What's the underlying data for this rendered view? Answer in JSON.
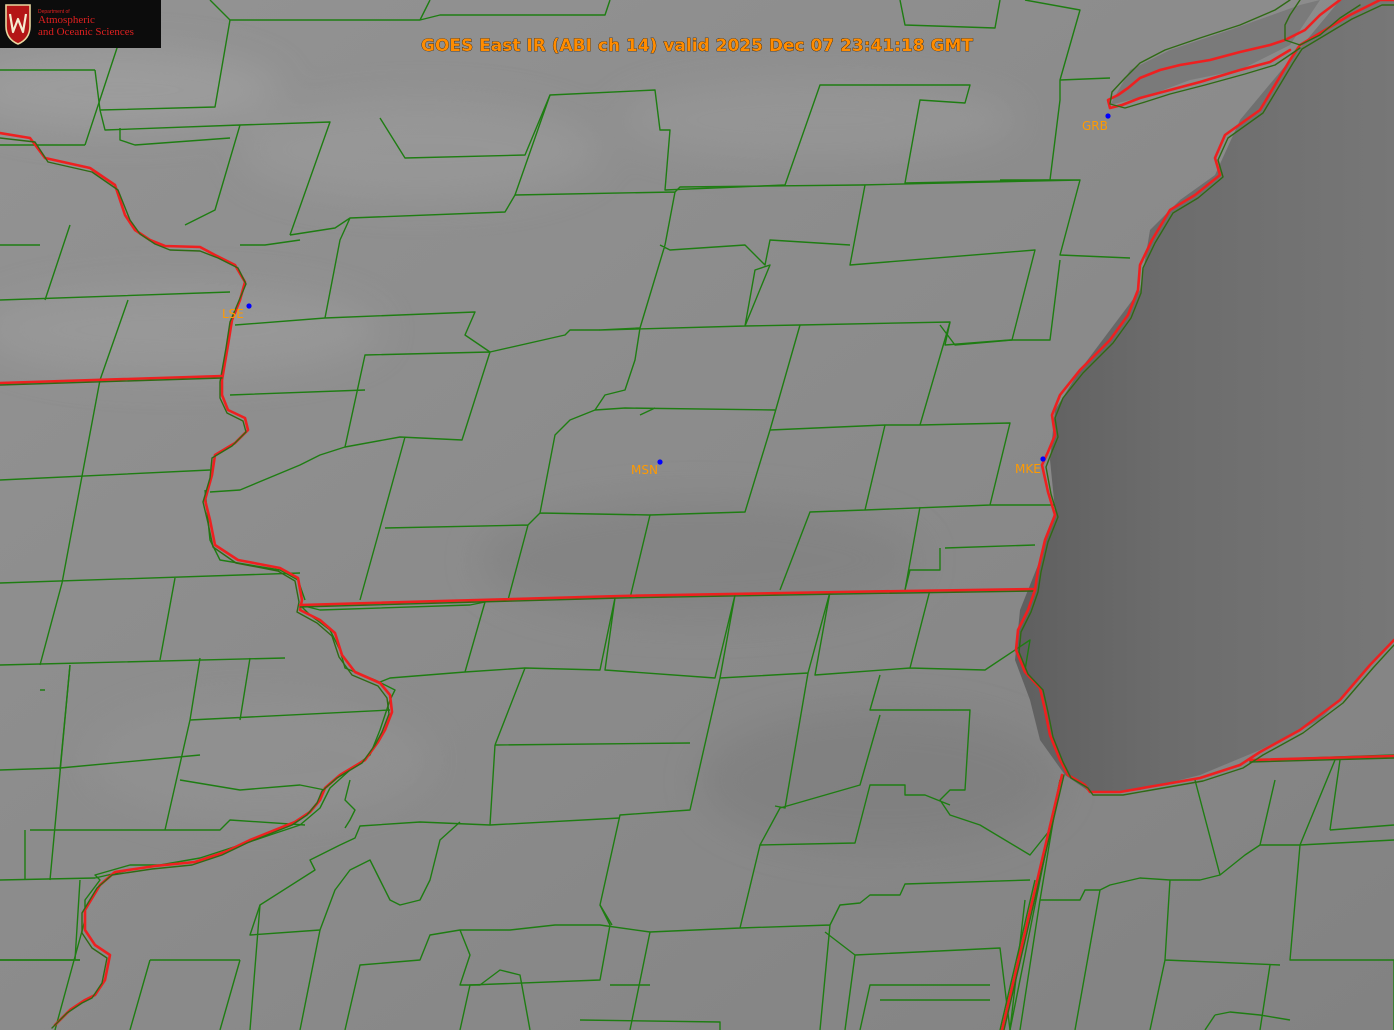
{
  "title": "GOES East IR (ABI ch 14) valid 2025 Dec 07 23:41:18 GMT",
  "logo": {
    "department_small": "Department of",
    "line1": "Atmospheric",
    "line2": "and Oceanic Sciences",
    "crest_letter": "W"
  },
  "stations": [
    {
      "id": "LSE"
    },
    {
      "id": "GRB"
    },
    {
      "id": "MSN"
    },
    {
      "id": "MKE"
    }
  ],
  "colors": {
    "county_lines": "#1e7d12",
    "coastline_state_lines": "#ee2020",
    "station_marker": "#0000ff",
    "station_label": "#ff9a00",
    "title_text": "#ff8c00",
    "logo_text": "#e02020",
    "logo_background": "#0c0c0c",
    "land_cloud_gray": "#8a8a8a",
    "lake_gray": "#6e6e6e"
  }
}
